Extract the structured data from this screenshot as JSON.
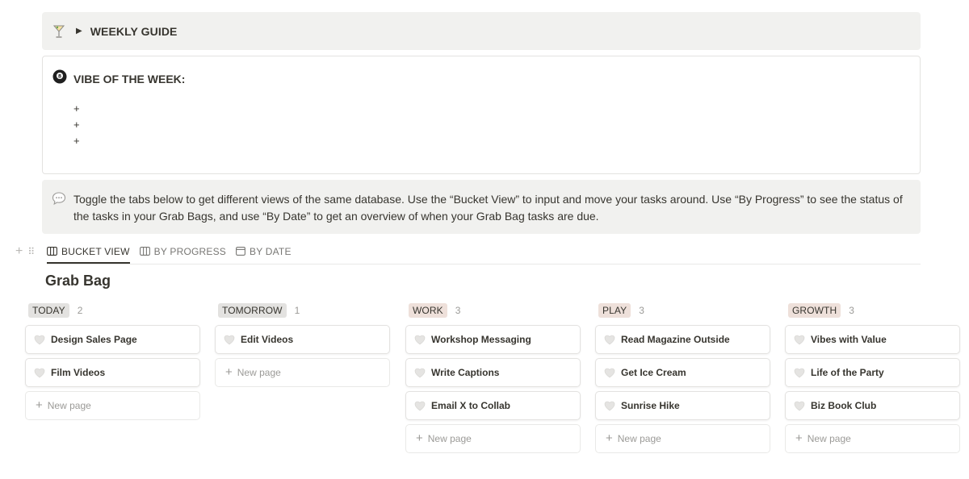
{
  "weekly_guide": {
    "title": "WEEKLY GUIDE",
    "icon": "cocktail-icon"
  },
  "vibe": {
    "title": "VIBE OF THE WEEK:",
    "icon": "8-ball-icon",
    "items": [
      "+",
      "+",
      "+"
    ]
  },
  "callout": {
    "icon": "speech-bubble-icon",
    "text": "Toggle the tabs below to get different views of the same database. Use the “Bucket View” to input and move your tasks around. Use “By Progress” to see the status of the tasks in your Grab Bags, and use “By Date” to get an overview of when your Grab Bag tasks are due."
  },
  "tabs": [
    {
      "label": "BUCKET VIEW",
      "icon": "board-icon",
      "active": true
    },
    {
      "label": "BY PROGRESS",
      "icon": "board-icon",
      "active": false
    },
    {
      "label": "BY DATE",
      "icon": "calendar-icon",
      "active": false
    }
  ],
  "database": {
    "title": "Grab Bag"
  },
  "new_page_label": "New page",
  "colors": {
    "tag_gray": "#e3e2e0",
    "tag_brown": "#eee0da",
    "heart": "#e9e9e7"
  },
  "columns": [
    {
      "name": "TODAY",
      "count": "2",
      "tag_color": "#e3e2e0",
      "cards": [
        "Design Sales Page",
        "Film Videos"
      ]
    },
    {
      "name": "TOMORROW",
      "count": "1",
      "tag_color": "#e3e2e0",
      "cards": [
        "Edit Videos"
      ]
    },
    {
      "name": "WORK",
      "count": "3",
      "tag_color": "#eee0da",
      "cards": [
        "Workshop Messaging",
        "Write Captions",
        "Email X to Collab"
      ]
    },
    {
      "name": "PLAY",
      "count": "3",
      "tag_color": "#eee0da",
      "cards": [
        "Read Magazine Outside",
        "Get Ice Cream",
        "Sunrise Hike"
      ]
    },
    {
      "name": "GROWTH",
      "count": "3",
      "tag_color": "#eee0da",
      "cards": [
        "Vibes with Value",
        "Life of the Party",
        "Biz Book Club"
      ]
    }
  ]
}
